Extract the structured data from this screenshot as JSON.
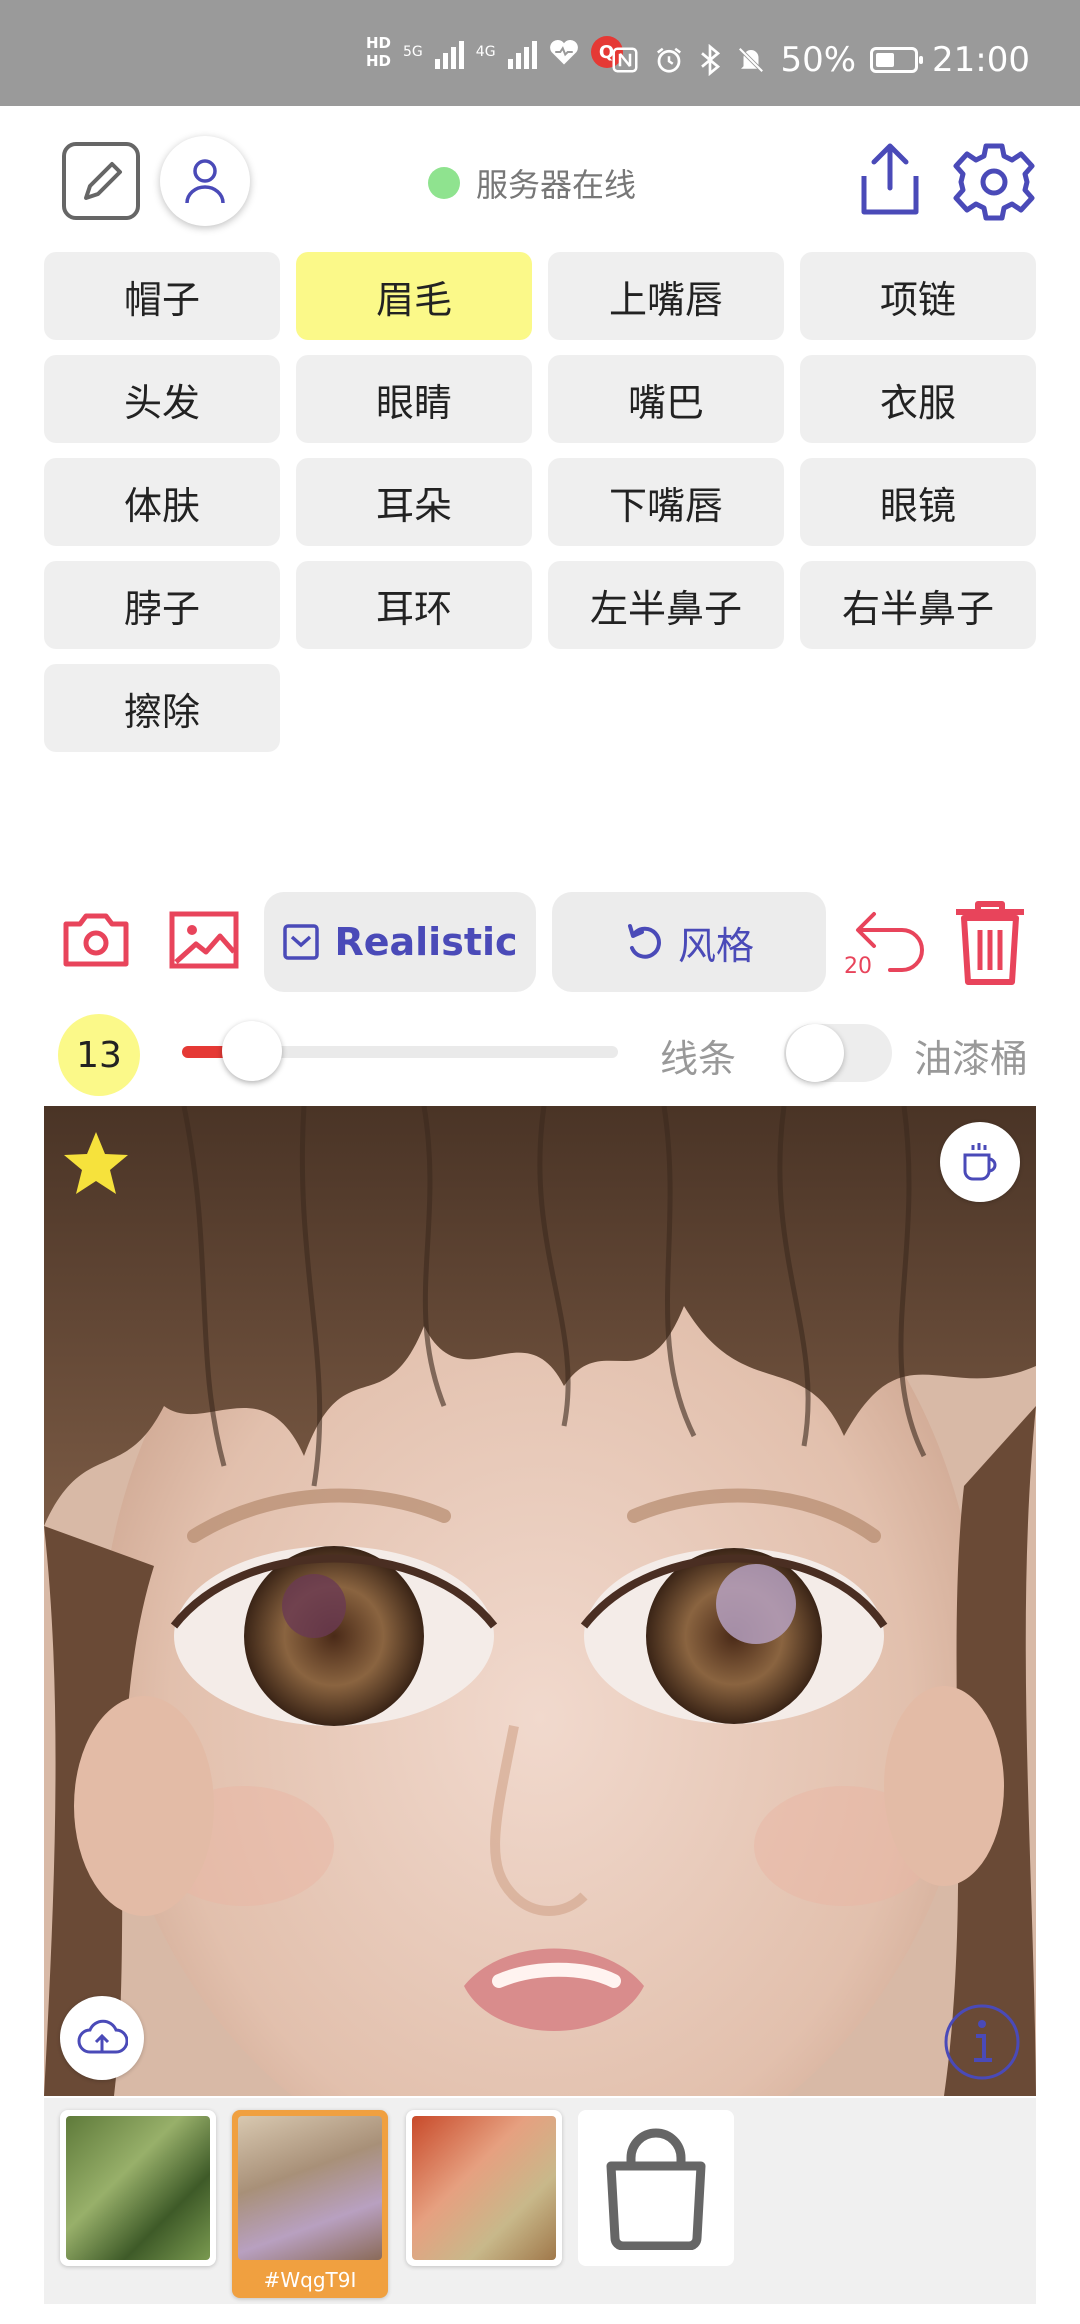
{
  "status_bar": {
    "hd1": "HD",
    "hd2": "HD",
    "net1": "5G",
    "net2": "4G",
    "battery_pct": "50%",
    "battery_level": 0.5,
    "time": "21:00"
  },
  "toolbar": {
    "server_status": "服务器在线",
    "server_color": "#8fe38f"
  },
  "categories": [
    {
      "label": "帽子",
      "active": false
    },
    {
      "label": "眉毛",
      "active": true
    },
    {
      "label": "上嘴唇",
      "active": false
    },
    {
      "label": "项链",
      "active": false
    },
    {
      "label": "头发",
      "active": false
    },
    {
      "label": "眼睛",
      "active": false
    },
    {
      "label": "嘴巴",
      "active": false
    },
    {
      "label": "衣服",
      "active": false
    },
    {
      "label": "体肤",
      "active": false
    },
    {
      "label": "耳朵",
      "active": false
    },
    {
      "label": "下嘴唇",
      "active": false
    },
    {
      "label": "眼镜",
      "active": false
    },
    {
      "label": "脖子",
      "active": false
    },
    {
      "label": "耳环",
      "active": false
    },
    {
      "label": "左半鼻子",
      "active": false
    },
    {
      "label": "右半鼻子",
      "active": false
    },
    {
      "label": "擦除",
      "active": false
    }
  ],
  "tools": {
    "realistic_label": "Realistic",
    "style_label": "风格",
    "undo_count": "20",
    "accent": "#e8445b",
    "pill_text": "#4a4ab8"
  },
  "brush": {
    "size": "13",
    "slider_value": 0.16,
    "line_label": "线条",
    "bucket_label": "油漆桶",
    "bucket_enabled": false
  },
  "canvas": {
    "icons": [
      "star-icon",
      "coffee-icon",
      "cloud-upload-icon",
      "info-icon"
    ]
  },
  "thumbnails": {
    "selected_tag": "#WqgT9I",
    "icons": [
      "shopping-bag-icon"
    ]
  }
}
